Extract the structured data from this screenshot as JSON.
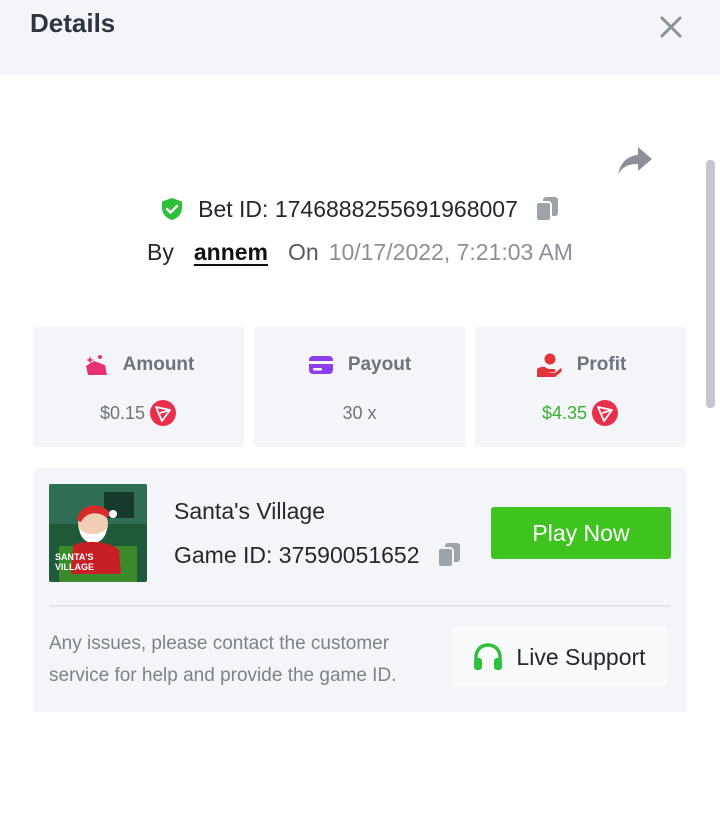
{
  "header": {
    "title": "Details"
  },
  "bet": {
    "id_label": "Bet ID: 1746888255691968007",
    "by_label": "By",
    "user": "annem",
    "on_label": "On",
    "date": "10/17/2022, 7:21:03 AM"
  },
  "stats": [
    {
      "label": "Amount",
      "value": "$0.15",
      "icon": "amount-icon",
      "icon_color": "#e5316f"
    },
    {
      "label": "Payout",
      "value": "30 x",
      "icon": "card-icon",
      "icon_color": "#8a3ef0"
    },
    {
      "label": "Profit",
      "value": "$4.35",
      "icon": "hand-coin-icon",
      "icon_color": "#e5333a"
    }
  ],
  "game": {
    "name": "Santa's Village",
    "id_label": "Game ID: 37590051652",
    "play_label": "Play Now",
    "thumb_text": "SANTA'S VILLAGE",
    "help_text": "Any issues, please contact the customer service for help and provide the game ID.",
    "support_label": "Live Support"
  },
  "colors": {
    "accent_green": "#3ec31f",
    "profit_green": "#3ab02f",
    "tron_red": "#e8304a"
  }
}
